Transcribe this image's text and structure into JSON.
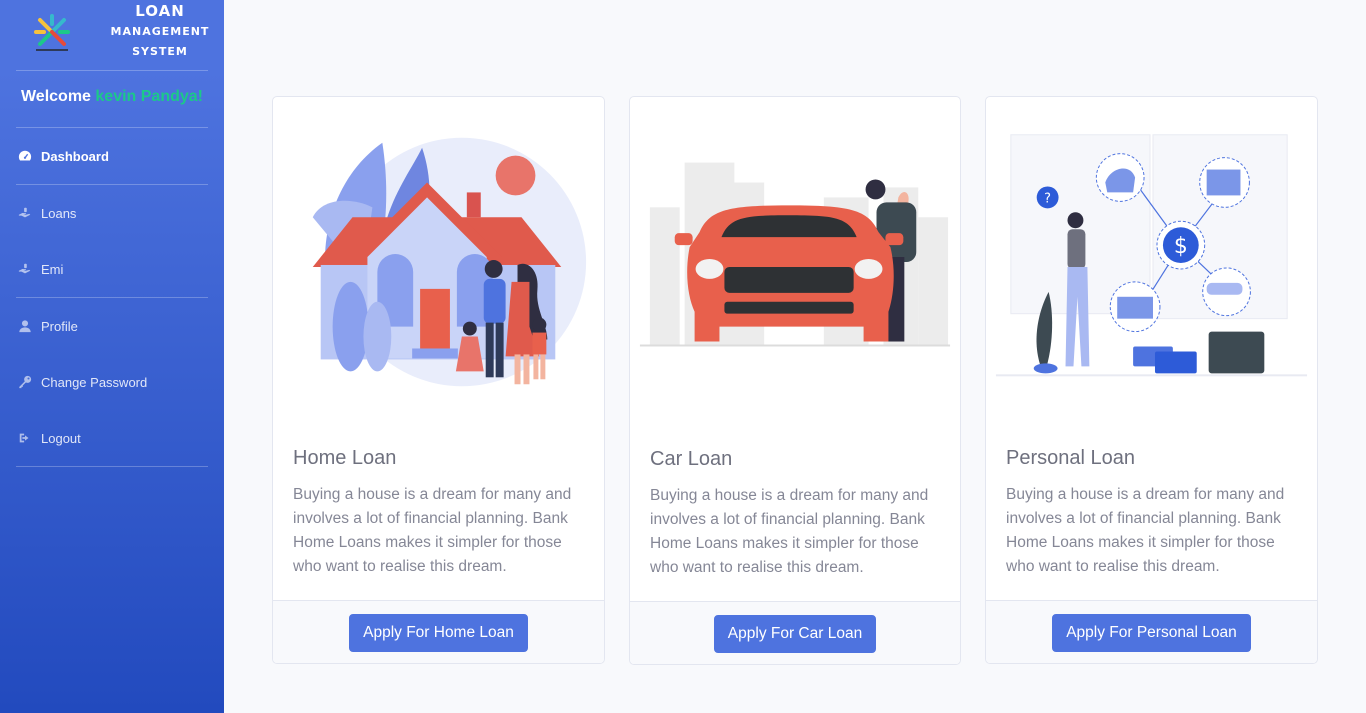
{
  "brand": {
    "line1": "LOAN",
    "line2": "MANAGEMENT",
    "line3": "SYSTEM",
    "logo_icon": "loan-system-logo"
  },
  "welcome": {
    "prefix": "Welcome",
    "user_name": "kevin Pandya!"
  },
  "sidebar": {
    "items": [
      {
        "label": "Dashboard",
        "icon": "tachometer-icon",
        "active": true
      },
      {
        "label": "Loans",
        "icon": "hand-holding-icon"
      },
      {
        "label": "Emi",
        "icon": "hand-holding-icon"
      },
      {
        "label": "Profile",
        "icon": "user-icon"
      },
      {
        "label": "Change Password",
        "icon": "key-icon"
      },
      {
        "label": "Logout",
        "icon": "sign-out-icon"
      }
    ]
  },
  "cards": [
    {
      "title": "Home Loan",
      "text": "Buying a house is a dream for many and involves a lot of financial planning. Bank Home Loans makes it simpler for those who want to realise this dream.",
      "button": "Apply For Home Loan",
      "illustration": "family-house-illustration"
    },
    {
      "title": "Car Loan",
      "text": "Buying a house is a dream for many and involves a lot of financial planning. Bank Home Loans makes it simpler for those who want to realise this dream.",
      "button": "Apply For Car Loan",
      "illustration": "man-with-car-illustration"
    },
    {
      "title": "Personal Loan",
      "text": "Buying a house is a dream for many and involves a lot of financial planning. Bank Home Loans makes it simpler for those who want to realise this dream.",
      "button": "Apply For Personal Loan",
      "illustration": "woman-thinking-finance-illustration"
    }
  ],
  "colors": {
    "primary": "#4e73df",
    "sidebar_gradient_end": "#224abe",
    "success": "#1cc88a",
    "house_red": "#e8604c",
    "illustration_blue": "#7b96e8"
  }
}
